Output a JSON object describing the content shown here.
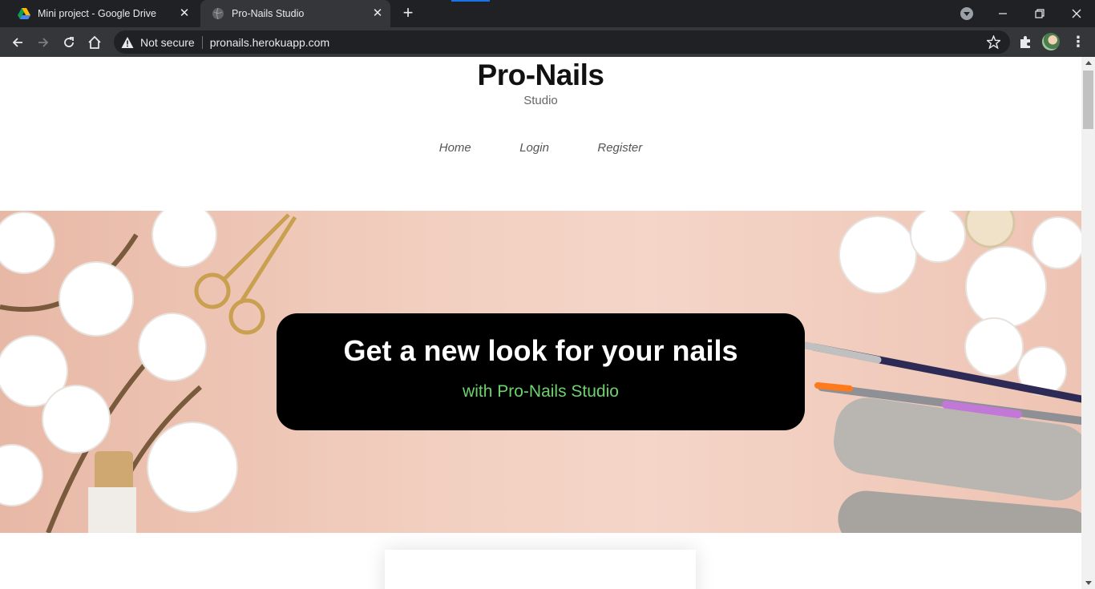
{
  "browser": {
    "tabs": [
      {
        "title": "Mini project - Google Drive",
        "active": false,
        "icon": "google-drive-icon"
      },
      {
        "title": "Pro-Nails Studio",
        "active": true,
        "icon": "globe-icon"
      }
    ],
    "security_label": "Not secure",
    "url": "pronails.herokuapp.com"
  },
  "site": {
    "brand_title": "Pro-Nails",
    "brand_subtitle": "Studio",
    "nav": [
      "Home",
      "Login",
      "Register"
    ],
    "hero": {
      "title": "Get a new look for your nails",
      "subtitle": "with Pro-Nails Studio"
    }
  },
  "colors": {
    "hero_subtitle": "#6cd36c",
    "hero_background": "#f2cfc0",
    "chrome_dark": "#202124"
  }
}
